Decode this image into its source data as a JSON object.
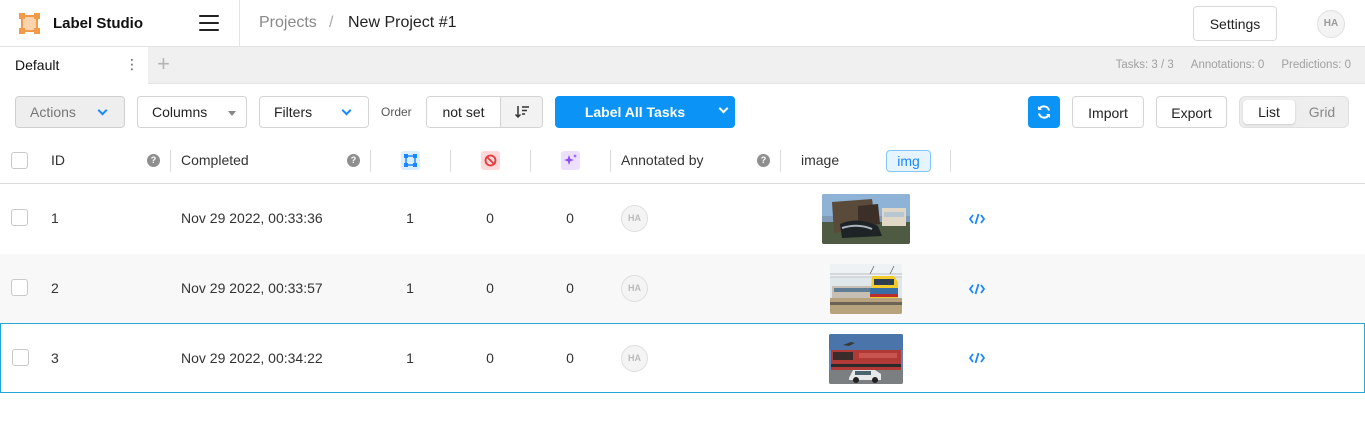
{
  "app": {
    "name": "Label Studio"
  },
  "breadcrumb": {
    "projects": "Projects",
    "separator": "/",
    "current": "New Project #1"
  },
  "header": {
    "settings_label": "Settings",
    "avatar_initials": "HA"
  },
  "tabs": [
    {
      "label": "Default",
      "active": true
    }
  ],
  "stats": {
    "tasks": "Tasks: 3 / 3",
    "annotations": "Annotations: 0",
    "predictions": "Predictions: 0"
  },
  "toolbar": {
    "actions_label": "Actions",
    "columns_label": "Columns",
    "filters_label": "Filters",
    "order_label": "Order",
    "order_value": "not set",
    "label_all_label": "Label All Tasks",
    "import_label": "Import",
    "export_label": "Export",
    "view_list_label": "List",
    "view_grid_label": "Grid",
    "active_view": "List"
  },
  "table": {
    "headers": {
      "id": "ID",
      "completed": "Completed",
      "annotated_by": "Annotated by",
      "image": "image",
      "image_tag": "img",
      "help_symbol": "?"
    },
    "column_icons": [
      "annotations-count-icon",
      "cancelled-count-icon",
      "predictions-count-icon"
    ],
    "rows": [
      {
        "id": "1",
        "completed": "Nov 29 2022, 00:33:36",
        "annotations": "1",
        "cancelled": "0",
        "predictions": "0",
        "annotator": "HA",
        "image_alt": "train crash with car"
      },
      {
        "id": "2",
        "completed": "Nov 29 2022, 00:33:57",
        "annotations": "1",
        "cancelled": "0",
        "predictions": "0",
        "annotator": "HA",
        "image_alt": "passenger train at station"
      },
      {
        "id": "3",
        "completed": "Nov 29 2022, 00:34:22",
        "annotations": "1",
        "cancelled": "0",
        "predictions": "0",
        "annotator": "HA",
        "image_alt": "red locomotive and white car"
      }
    ]
  },
  "colors": {
    "accent": "#0b93f5",
    "logo": "#f2994a",
    "selected_border": "#27a6d8",
    "annotations_icon_bg": "#d9efff",
    "cancelled_icon_bg": "#ffd9d9",
    "predictions_icon_bg": "#ede0ff"
  }
}
